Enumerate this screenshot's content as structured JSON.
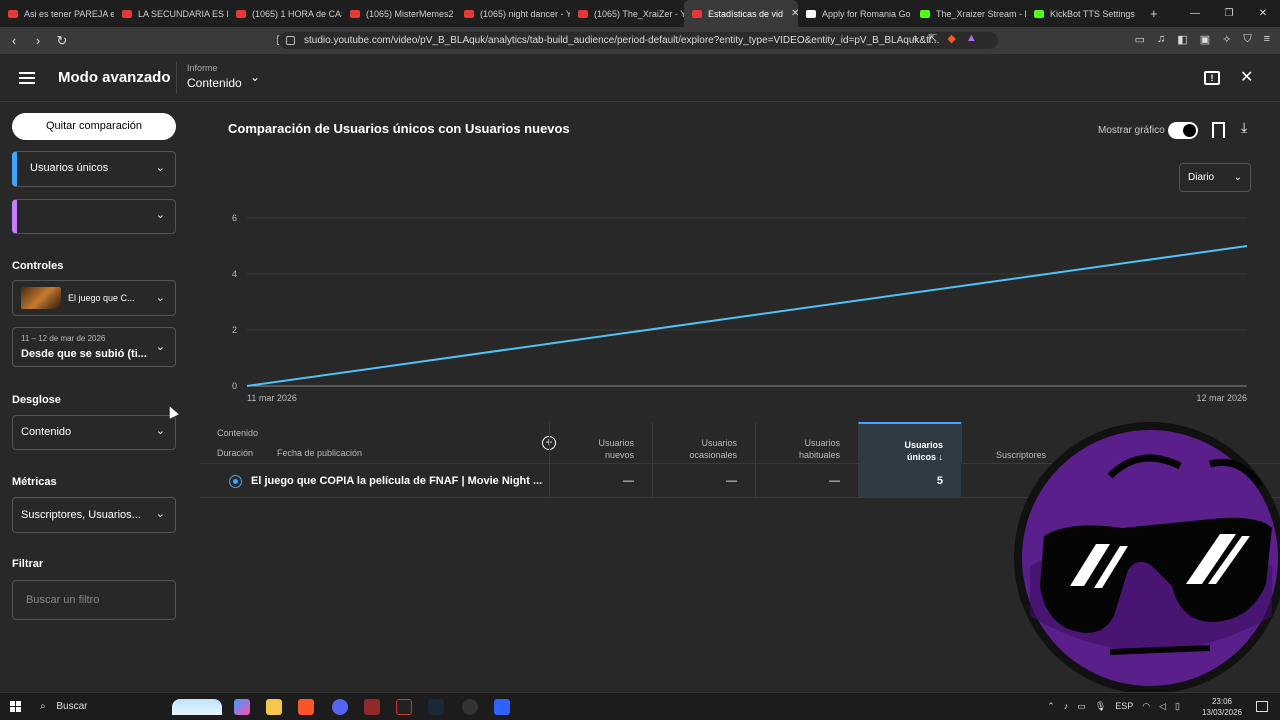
{
  "browser": {
    "tabs": [
      {
        "label": "Asi es tener PAREJA en",
        "color": "#e53935"
      },
      {
        "label": "LA SECUNDARIA ES ES",
        "color": "#e53935"
      },
      {
        "label": "(1065) 1 HORA de CAS",
        "color": "#e53935"
      },
      {
        "label": "(1065) MisterMemes2",
        "color": "#e53935"
      },
      {
        "label": "(1065) night dancer - Y",
        "color": "#e53935"
      },
      {
        "label": "(1065) The_XraiZer - Yo",
        "color": "#e53935"
      },
      {
        "label": "Estadísticas de vid",
        "color": "#e53935",
        "active": true,
        "close": "✕"
      },
      {
        "label": "Apply for Romania Go",
        "color": "#ffffff"
      },
      {
        "label": "The_Xraizer Stream - K",
        "color": "#53fc18"
      },
      {
        "label": "KickBot TTS Settings",
        "color": "#53fc18"
      }
    ],
    "new_tab": "+",
    "url": "studio.youtube.com/video/pV_B_BLAquk/analytics/tab-build_audience/period-default/explore?entity_type=VIDEO&entity_id=pV_B_BLAquk&ti..."
  },
  "header": {
    "title": "Modo avanzado",
    "informe_label": "Informe",
    "informe_value": "Contenido"
  },
  "sidebar": {
    "remove_compare": "Quitar comparación",
    "metric1": "Usuarios únicos",
    "metric1_color": "#3ea6ff",
    "metric2": "",
    "metric2_color": "#c77dff",
    "controles_label": "Controles",
    "video_select": "El juego que C...",
    "date_range": "11 – 12 de mar de 2026",
    "date_select": "Desde que se subió (ti...",
    "desglose_label": "Desglose",
    "desglose_value": "Contenido",
    "metricas_label": "Métricas",
    "metricas_value": "Suscriptores, Usuarios...",
    "filtrar_label": "Filtrar",
    "filter_placeholder": "Buscar un filtro"
  },
  "main": {
    "chart_title": "Comparación de Usuarios únicos con Usuarios nuevos",
    "show_graph": "Mostrar gráfico",
    "period": "Diario"
  },
  "chart_data": {
    "type": "line",
    "title": "Comparación de Usuarios únicos con Usuarios nuevos",
    "x": [
      "11 mar 2026",
      "12 mar 2026"
    ],
    "series": [
      {
        "name": "Usuarios únicos",
        "values": [
          0,
          5
        ],
        "color": "#4fc3f7"
      }
    ],
    "yticks": [
      0,
      2,
      4,
      6
    ],
    "ylim": [
      0,
      6
    ],
    "xlabel": "",
    "ylabel": ""
  },
  "table": {
    "header_top": "Contenido",
    "col_a": "Duración",
    "col_b": "Fecha de publicación",
    "columns": [
      {
        "l1": "Usuarios",
        "l2": "nuevos"
      },
      {
        "l1": "Usuarios",
        "l2": "ocasionales"
      },
      {
        "l1": "Usuarios",
        "l2": "habituales"
      },
      {
        "l1": "Usuarios",
        "l2": "únicos ↓",
        "active": true
      },
      {
        "l1": "",
        "l2": "Suscriptores"
      }
    ],
    "row": {
      "title": "El juego que COPIA la película de FNAF | Movie Night ...",
      "values": [
        "—",
        "—",
        "—",
        "5"
      ]
    }
  },
  "taskbar": {
    "search": "Buscar",
    "lang": "ESP",
    "time": "23:06",
    "date": "13/03/2026"
  }
}
